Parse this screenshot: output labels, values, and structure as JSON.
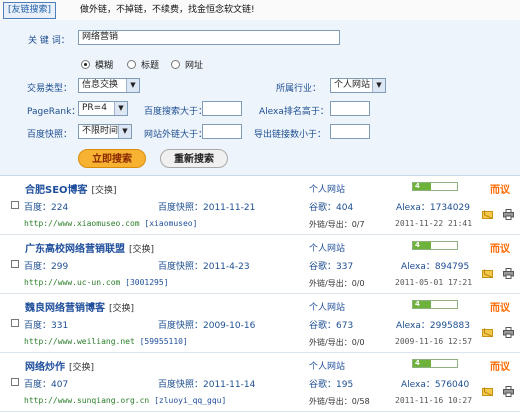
{
  "header": {
    "tab_label": "[友链搜索]",
    "notice": "做外链，不掉链，不续费，找金恒念软文链!"
  },
  "form": {
    "keyword_label": "关 键 词：",
    "keyword_value": "网络营销",
    "search_modes": [
      {
        "label": "模糊",
        "selected": true
      },
      {
        "label": "标题",
        "selected": false
      },
      {
        "label": "网址",
        "selected": false
      }
    ],
    "trade_type_label": "交易类型：",
    "trade_type_value": "信息交换",
    "industry_label": "所属行业：",
    "industry_value": "个人网站",
    "pagerank_label": "PageRank：",
    "pagerank_value": "PR=4",
    "baidu_search_label": "百度搜索大于：",
    "baidu_search_value": "",
    "alexa_label": "Alexa排名高于：",
    "alexa_value": "",
    "baidu_snapshot_label": "百度快照：",
    "baidu_snapshot_value": "不限时间",
    "outlinks_label": "网站外链大于：",
    "outlinks_value": "",
    "export_links_label": "导出链接数小于：",
    "export_links_value": "",
    "search_button": "立即搜索",
    "research_button": "重新搜索"
  },
  "results": [
    {
      "site_name": "合肥SEO博客",
      "swap_tag": "[交换]",
      "industry": "个人网站",
      "pagerank": 4,
      "brand": "而议",
      "baidu": "百度：224",
      "snapshot": "百度快照：2011-11-21",
      "google": "谷歌：404",
      "alexa": "Alexa：1734029",
      "url": "http://www.xiaomuseo.com",
      "user_id": "[xiaomuseo]",
      "outlinks": "外链/导出：0/7",
      "date": "2011-11-22 21:41"
    },
    {
      "site_name": "广东高校网络营销联盟",
      "swap_tag": "[交换]",
      "industry": "个人网站",
      "pagerank": 4,
      "brand": "而议",
      "baidu": "百度：299",
      "snapshot": "百度快照：2011-4-23",
      "google": "谷歌：337",
      "alexa": "Alexa：894795",
      "url": "http://www.uc-un.com",
      "user_id": "[3001295]",
      "outlinks": "外链/导出：0/0",
      "date": "2011-05-01 17:21"
    },
    {
      "site_name": "魏良网络营销博客",
      "swap_tag": "[交换]",
      "industry": "个人网站",
      "pagerank": 4,
      "brand": "而议",
      "baidu": "百度：331",
      "snapshot": "百度快照：2009-10-16",
      "google": "谷歌：673",
      "alexa": "Alexa：2995883",
      "url": "http://www.weiliang.net",
      "user_id": "[59955110]",
      "outlinks": "外链/导出：0/0",
      "date": "2009-11-16 12:57"
    },
    {
      "site_name": "网络炒作",
      "swap_tag": "[交换]",
      "industry": "个人网站",
      "pagerank": 4,
      "brand": "而议",
      "baidu": "百度：407",
      "snapshot": "百度快照：2011-11-14",
      "google": "谷歌：195",
      "alexa": "Alexa：576040",
      "url": "http://www.sunqiang.org.cn",
      "user_id": "[zluoyi_qq_gqu]",
      "outlinks": "外链/导出：0/58",
      "date": "2011-11-16 10:27"
    }
  ]
}
